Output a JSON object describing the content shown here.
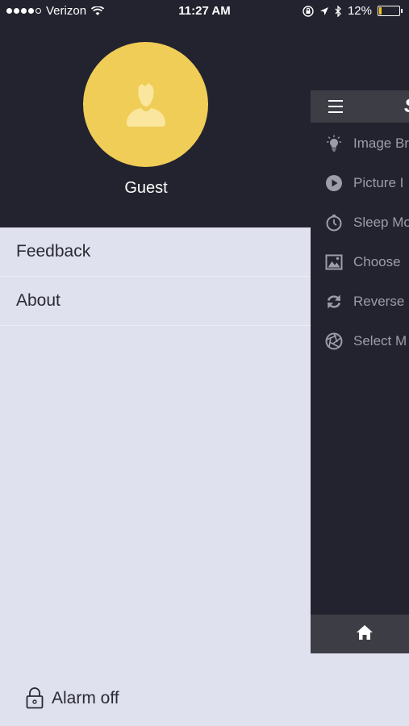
{
  "status_bar": {
    "carrier": "Verizon",
    "time": "11:27 AM",
    "battery": "12%",
    "battery_level": 0.12,
    "battery_color": "#f2c318"
  },
  "drawer": {
    "user_name": "Guest",
    "avatar_icon": "user-silhouette-icon",
    "avatar_color": "#f0cd56",
    "items": [
      {
        "label": "Feedback"
      },
      {
        "label": "About"
      }
    ],
    "alarm": {
      "icon": "lock-icon",
      "label": "Alarm off"
    }
  },
  "main": {
    "toolbar_title_fragment": "S",
    "menu_items": [
      {
        "icon": "lightbulb-icon",
        "label": "Image Bri"
      },
      {
        "icon": "play-circle-icon",
        "label": "Picture I"
      },
      {
        "icon": "timer-icon",
        "label": "Sleep Mo"
      },
      {
        "icon": "image-icon",
        "label": "Choose"
      },
      {
        "icon": "reverse-arrows-icon",
        "label": "Reverse"
      },
      {
        "icon": "aperture-icon",
        "label": "Select M"
      }
    ],
    "bottom_nav": {
      "icon": "home-icon"
    }
  },
  "colors": {
    "dark_bg": "#23232f",
    "toolbar_bg": "#3d3d45",
    "drawer_bg": "#dfe1ee",
    "menu_text": "#9d9da8"
  }
}
